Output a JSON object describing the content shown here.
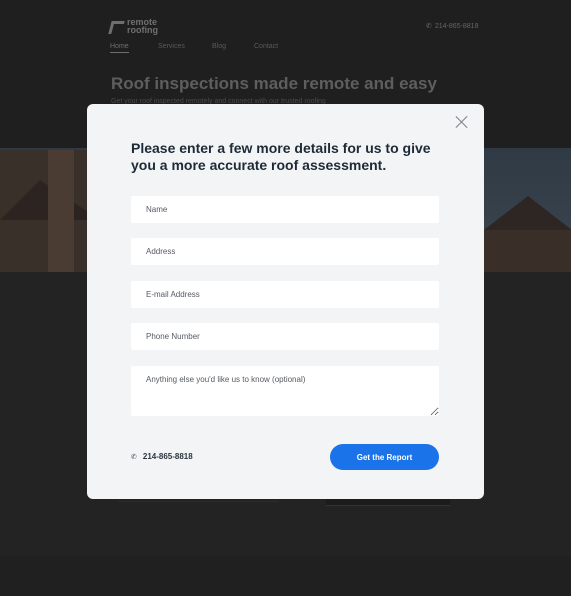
{
  "header": {
    "logo_line1": "remote",
    "logo_line2": "roofing",
    "phone": "214-865-8818"
  },
  "nav": {
    "items": [
      {
        "label": "Home"
      },
      {
        "label": "Services"
      },
      {
        "label": "Blog"
      },
      {
        "label": "Contact"
      }
    ]
  },
  "hero": {
    "title": "Roof inspections made remote and easy",
    "subtitle": "Get your roof inspected remotely and connect with our trusted roofing"
  },
  "modal": {
    "title": "Please enter a few more details for us to give you a more accurate roof assessment.",
    "fields": {
      "name_placeholder": "Name",
      "address_placeholder": "Address",
      "email_placeholder": "E-mail Address",
      "phone_placeholder": "Phone Number",
      "notes_placeholder": "Anything else you'd like us to know (optional)"
    },
    "phone": "214-865-8818",
    "submit_label": "Get  the Report"
  },
  "colors": {
    "accent": "#1a73e8",
    "modal_bg": "#f3f4f6",
    "overlay_bg": "#232323"
  },
  "icons": {
    "close": "close-icon",
    "phone": "phone-icon",
    "logo": "logo-icon"
  }
}
